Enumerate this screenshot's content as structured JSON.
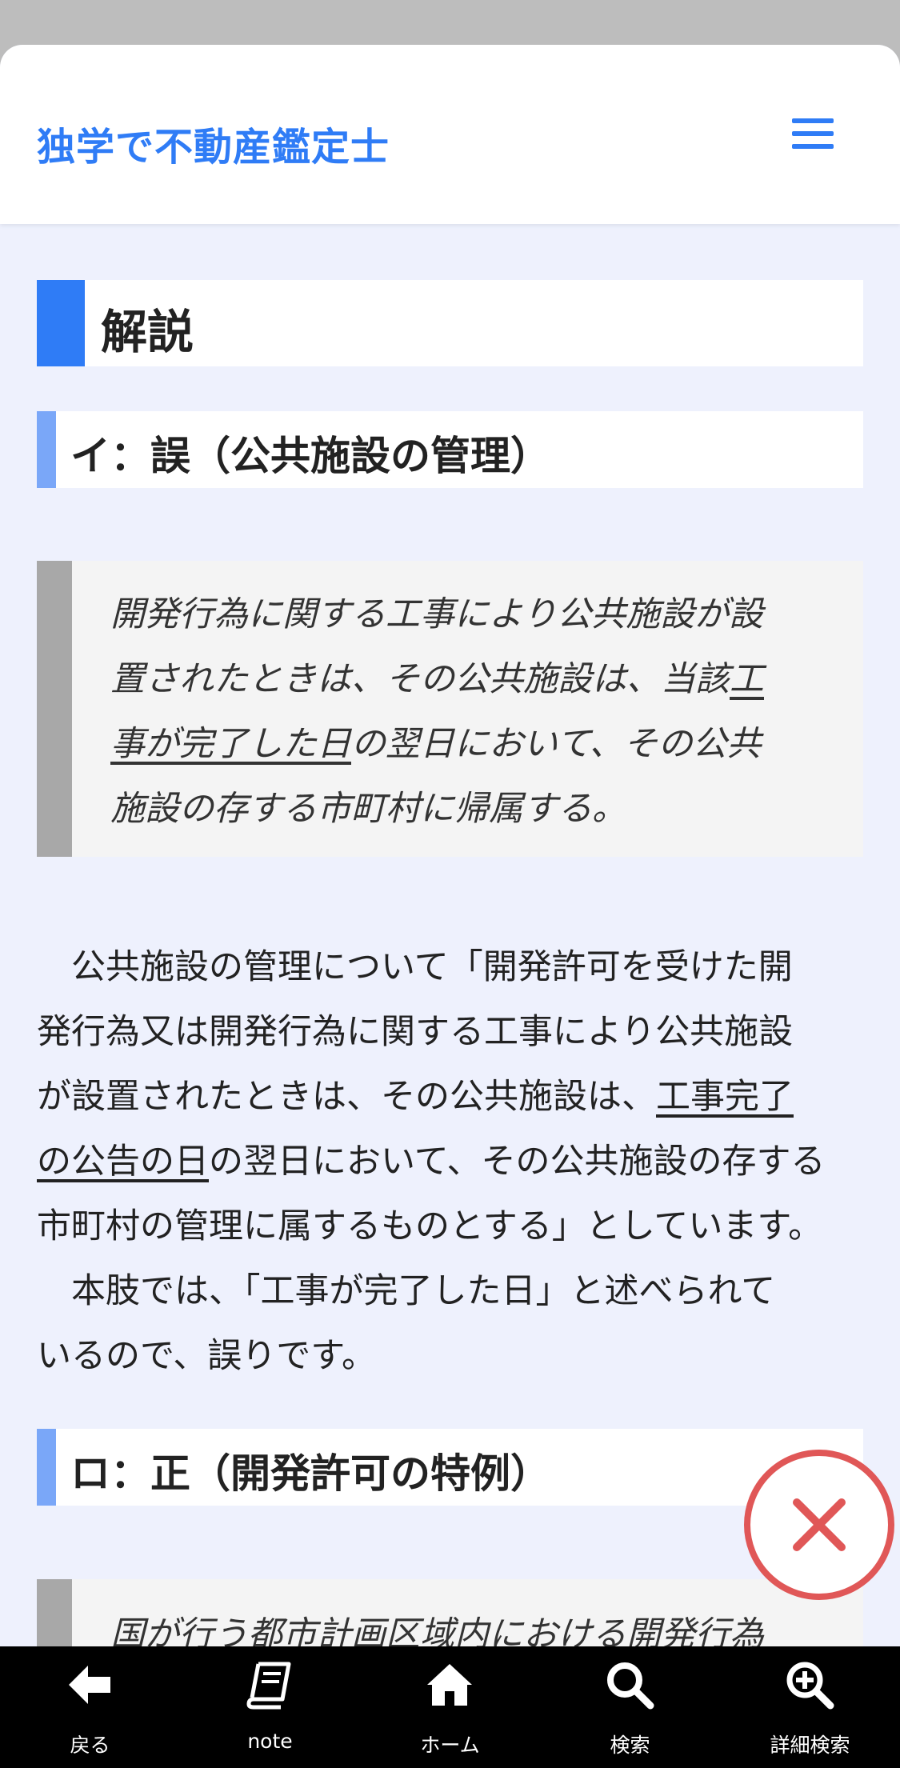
{
  "header": {
    "site_title": "独学で不動産鑑定士",
    "menu_icon": "hamburger-menu-icon"
  },
  "section_title": "解説",
  "item_a": {
    "heading": "イ：誤（公共施設の管理）",
    "quote_lines": [
      {
        "pre": "開発行為に関する工事により公共施設が設",
        "ul": "",
        "post": ""
      },
      {
        "pre": "置されたときは、その公共施設は、当該",
        "ul": "工",
        "post": ""
      },
      {
        "pre": "",
        "ul": "事が完了した日",
        "post": "の翌日において、その公共"
      },
      {
        "pre": "施設の存する市町村に帰属する。",
        "ul": "",
        "post": ""
      }
    ],
    "para_lines": [
      {
        "pre": "　公共施設の管理について「開発許可を受けた開",
        "ul": "",
        "post": ""
      },
      {
        "pre": "発行為又は開発行為に関する工事により公共施設",
        "ul": "",
        "post": ""
      },
      {
        "pre": "が設置されたときは、その公共施設は、",
        "ul": "工事完了",
        "post": ""
      },
      {
        "pre": "",
        "ul": "の公告の日",
        "post": "の翌日において、その公共施設の存する"
      },
      {
        "pre": "市町村の管理に属するものとする」としています。",
        "ul": "",
        "post": ""
      },
      {
        "pre": "　本肢では、「工事が完了した日」と述べられて",
        "ul": "",
        "post": ""
      },
      {
        "pre": "いるので、誤りです。",
        "ul": "",
        "post": ""
      }
    ]
  },
  "item_b": {
    "heading": "ロ：正（開発許可の特例）",
    "quote_lines": [
      {
        "pre": "国が行う都市計画区域内における開発行為",
        "ul": "",
        "post": ""
      }
    ]
  },
  "close_icon": "close-x-icon",
  "bottom_nav": [
    {
      "label": "戻る",
      "icon": "back-arrow-icon"
    },
    {
      "label": "note",
      "icon": "book-icon"
    },
    {
      "label": "ホーム",
      "icon": "home-icon"
    },
    {
      "label": "検索",
      "icon": "search-icon"
    },
    {
      "label": "詳細検索",
      "icon": "zoom-plus-icon"
    }
  ],
  "colors": {
    "accent": "#2f7cf6",
    "heading_bar": "#7aa7f8",
    "quote_bar": "#a8a8a8",
    "close": "#e05757",
    "background": "#eef1fd"
  }
}
